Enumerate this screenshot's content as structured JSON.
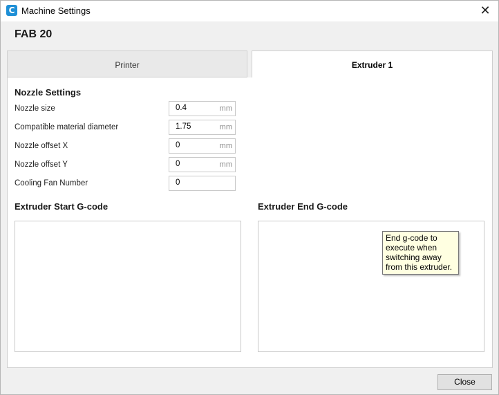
{
  "window": {
    "title": "Machine Settings",
    "close_glyph": "✕"
  },
  "app_icon_letter": "C",
  "machine_name": "FAB 20",
  "tabs": [
    {
      "label": "Printer",
      "active": false
    },
    {
      "label": "Extruder 1",
      "active": true
    }
  ],
  "nozzle_settings": {
    "title": "Nozzle Settings",
    "rows": [
      {
        "label": "Nozzle size",
        "value": "0.4",
        "unit": "mm"
      },
      {
        "label": "Compatible material diameter",
        "value": "1.75",
        "unit": "mm"
      },
      {
        "label": "Nozzle offset X",
        "value": "0",
        "unit": "mm"
      },
      {
        "label": "Nozzle offset Y",
        "value": "0",
        "unit": "mm"
      },
      {
        "label": "Cooling Fan Number",
        "value": "0",
        "unit": ""
      }
    ]
  },
  "start_gcode": {
    "title": "Extruder Start G-code",
    "value": ""
  },
  "end_gcode": {
    "title": "Extruder End G-code",
    "value": "",
    "tooltip": "End g-code to execute when switching away from this extruder."
  },
  "footer": {
    "close_label": "Close"
  },
  "colors": {
    "app_icon": "#1e8fd6",
    "tooltip_bg": "#ffffe1"
  }
}
